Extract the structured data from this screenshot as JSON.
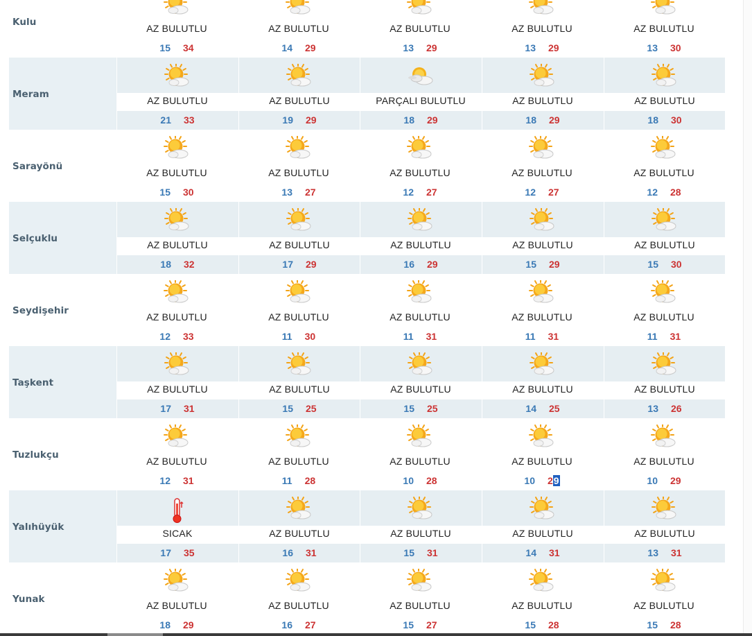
{
  "rows": [
    {
      "name": "Kulu",
      "days": [
        {
          "icon": "partly-sunny-icon",
          "cond": "AZ BULUTLU",
          "min": "15",
          "max": "34"
        },
        {
          "icon": "partly-sunny-icon",
          "cond": "AZ BULUTLU",
          "min": "14",
          "max": "29"
        },
        {
          "icon": "partly-sunny-icon",
          "cond": "AZ BULUTLU",
          "min": "13",
          "max": "29"
        },
        {
          "icon": "partly-sunny-icon",
          "cond": "AZ BULUTLU",
          "min": "13",
          "max": "29"
        },
        {
          "icon": "partly-sunny-icon",
          "cond": "AZ BULUTLU",
          "min": "13",
          "max": "30"
        }
      ]
    },
    {
      "name": "Meram",
      "days": [
        {
          "icon": "partly-sunny-icon",
          "cond": "AZ BULUTLU",
          "min": "21",
          "max": "33"
        },
        {
          "icon": "partly-sunny-icon",
          "cond": "AZ BULUTLU",
          "min": "19",
          "max": "29"
        },
        {
          "icon": "partly-cloudy-icon",
          "cond": "PARÇALI BULUTLU",
          "min": "18",
          "max": "29"
        },
        {
          "icon": "partly-sunny-icon",
          "cond": "AZ BULUTLU",
          "min": "18",
          "max": "29"
        },
        {
          "icon": "partly-sunny-icon",
          "cond": "AZ BULUTLU",
          "min": "18",
          "max": "30"
        }
      ]
    },
    {
      "name": "Sarayönü",
      "days": [
        {
          "icon": "partly-sunny-icon",
          "cond": "AZ BULUTLU",
          "min": "15",
          "max": "30"
        },
        {
          "icon": "partly-sunny-icon",
          "cond": "AZ BULUTLU",
          "min": "13",
          "max": "27"
        },
        {
          "icon": "partly-sunny-icon",
          "cond": "AZ BULUTLU",
          "min": "12",
          "max": "27"
        },
        {
          "icon": "partly-sunny-icon",
          "cond": "AZ BULUTLU",
          "min": "12",
          "max": "27"
        },
        {
          "icon": "partly-sunny-icon",
          "cond": "AZ BULUTLU",
          "min": "12",
          "max": "28"
        }
      ]
    },
    {
      "name": "Selçuklu",
      "days": [
        {
          "icon": "partly-sunny-icon",
          "cond": "AZ BULUTLU",
          "min": "18",
          "max": "32"
        },
        {
          "icon": "partly-sunny-icon",
          "cond": "AZ BULUTLU",
          "min": "17",
          "max": "29"
        },
        {
          "icon": "partly-sunny-icon",
          "cond": "AZ BULUTLU",
          "min": "16",
          "max": "29"
        },
        {
          "icon": "partly-sunny-icon",
          "cond": "AZ BULUTLU",
          "min": "15",
          "max": "29"
        },
        {
          "icon": "partly-sunny-icon",
          "cond": "AZ BULUTLU",
          "min": "15",
          "max": "30"
        }
      ]
    },
    {
      "name": "Seydişehir",
      "days": [
        {
          "icon": "partly-sunny-icon",
          "cond": "AZ BULUTLU",
          "min": "12",
          "max": "33"
        },
        {
          "icon": "partly-sunny-icon",
          "cond": "AZ BULUTLU",
          "min": "11",
          "max": "30"
        },
        {
          "icon": "partly-sunny-icon",
          "cond": "AZ BULUTLU",
          "min": "11",
          "max": "31"
        },
        {
          "icon": "partly-sunny-icon",
          "cond": "AZ BULUTLU",
          "min": "11",
          "max": "31"
        },
        {
          "icon": "partly-sunny-icon",
          "cond": "AZ BULUTLU",
          "min": "11",
          "max": "31"
        }
      ]
    },
    {
      "name": "Taşkent",
      "days": [
        {
          "icon": "partly-sunny-icon",
          "cond": "AZ BULUTLU",
          "min": "17",
          "max": "31"
        },
        {
          "icon": "partly-sunny-icon",
          "cond": "AZ BULUTLU",
          "min": "15",
          "max": "25"
        },
        {
          "icon": "partly-sunny-icon",
          "cond": "AZ BULUTLU",
          "min": "15",
          "max": "25"
        },
        {
          "icon": "partly-sunny-icon",
          "cond": "AZ BULUTLU",
          "min": "14",
          "max": "25"
        },
        {
          "icon": "partly-sunny-icon",
          "cond": "AZ BULUTLU",
          "min": "13",
          "max": "26"
        }
      ]
    },
    {
      "name": "Tuzlukçu",
      "days": [
        {
          "icon": "partly-sunny-icon",
          "cond": "AZ BULUTLU",
          "min": "12",
          "max": "31"
        },
        {
          "icon": "partly-sunny-icon",
          "cond": "AZ BULUTLU",
          "min": "11",
          "max": "28"
        },
        {
          "icon": "partly-sunny-icon",
          "cond": "AZ BULUTLU",
          "min": "10",
          "max": "28"
        },
        {
          "icon": "partly-sunny-icon",
          "cond": "AZ BULUTLU",
          "min": "10",
          "max": "29",
          "selected_part": "9"
        },
        {
          "icon": "partly-sunny-icon",
          "cond": "AZ BULUTLU",
          "min": "10",
          "max": "29"
        }
      ]
    },
    {
      "name": "Yalıhüyük",
      "days": [
        {
          "icon": "thermometer-hot-icon",
          "cond": "SICAK",
          "min": "17",
          "max": "35"
        },
        {
          "icon": "partly-sunny-icon",
          "cond": "AZ BULUTLU",
          "min": "16",
          "max": "31"
        },
        {
          "icon": "partly-sunny-icon",
          "cond": "AZ BULUTLU",
          "min": "15",
          "max": "31"
        },
        {
          "icon": "partly-sunny-icon",
          "cond": "AZ BULUTLU",
          "min": "14",
          "max": "31"
        },
        {
          "icon": "partly-sunny-icon",
          "cond": "AZ BULUTLU",
          "min": "13",
          "max": "31"
        }
      ]
    },
    {
      "name": "Yunak",
      "days": [
        {
          "icon": "partly-sunny-icon",
          "cond": "AZ BULUTLU",
          "min": "18",
          "max": "29"
        },
        {
          "icon": "partly-sunny-icon",
          "cond": "AZ BULUTLU",
          "min": "16",
          "max": "27"
        },
        {
          "icon": "partly-sunny-icon",
          "cond": "AZ BULUTLU",
          "min": "15",
          "max": "27"
        },
        {
          "icon": "partly-sunny-icon",
          "cond": "AZ BULUTLU",
          "min": "15",
          "max": "28"
        },
        {
          "icon": "partly-sunny-icon",
          "cond": "AZ BULUTLU",
          "min": "15",
          "max": "28"
        }
      ]
    }
  ],
  "colors": {
    "min_temp": "#3a79b5",
    "max_temp": "#cc3333",
    "row_shade": "#e6eef2",
    "district_name": "#4a6070",
    "selection": "#1f5fbf"
  }
}
